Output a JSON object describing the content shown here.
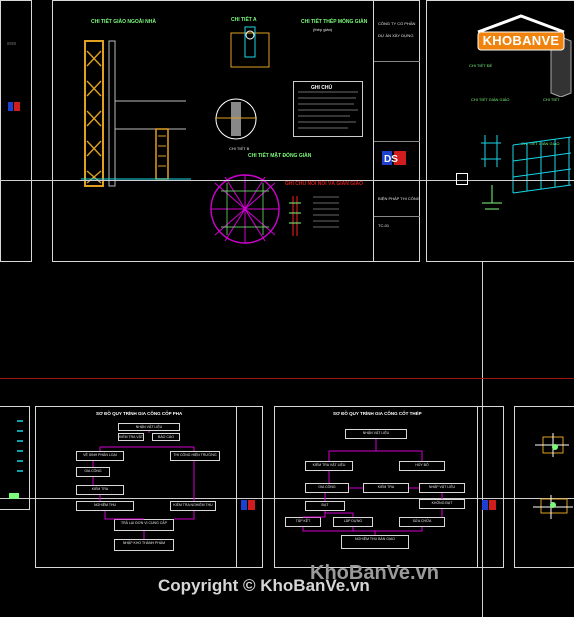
{
  "logo": {
    "text": "KHOBANVE",
    "color": "#f0830d"
  },
  "watermarks": {
    "main": "KhoBanVe.vn",
    "copyright": "Copyright © KhoBanVe.vn"
  },
  "sheet_top_mid": {
    "title_left": "CHI TIẾT GIÀO NGOÀI NHÀ",
    "title_mid": "CHI TIẾT A",
    "title_right": "CHI TIẾT THÉP MÓNG GIÀN",
    "subtitle_right": "(thép giàn)",
    "title_bottom": "CHI TIẾT MẶT ĐÓNG GIÀN",
    "detail_b": "CHI TIẾT B",
    "notes_title": "GHI CHÚ",
    "notes_title2": "GHI CHÚ NỐI NỐI VÀ GIÀN GIÀO",
    "sheet_label": "BẢN VẼ THI CÔNG"
  },
  "sheet_top_right": {
    "label1": "CHI TIẾT ĐẾ",
    "label2": "CHI TIẾT GIÀN GIÁO",
    "label3": "CHI TIẾT",
    "label4": "CHI TIẾT GIÀN GIÁO"
  },
  "sheet_bottom_mid": {
    "title": "SƠ ĐỒ QUY TRÌNH GIA CÔNG CỐP PHA",
    "nodes": [
      "NHẬN VẬT LIỆU",
      "KIỂM TRA VẬT LIỆU",
      "BÁO CÁO",
      "VỆ SINH PHÂN LOẠI",
      "THI CÔNG HIỆN TRƯỜNG",
      "GIA CÔNG",
      "KIỂM TRA",
      "NGHIỆM THU",
      "KIỂM TRA NGHIỆM THU",
      "TRẢ LẠI ĐƠN VỊ CUNG CẤP",
      "NHẬP KHO THÀNH PHẨM",
      "BÀN GIAO CHO BỘ PHẬN LẮP DỰNG"
    ]
  },
  "sheet_bottom_right": {
    "title": "SƠ ĐỒ QUY TRÌNH GIA CÔNG CỐT THÉP",
    "nodes": [
      "NHẬN VẬT LIỆU",
      "KIỂM TRA VẬT LIỆU",
      "NHẬP VẬT LIỆU",
      "HỦY BỎ",
      "GIA CÔNG",
      "KIỂM TRA",
      "ĐẠT",
      "KHÔNG ĐẠT",
      "SỬA CHỮA",
      "TẬP KẾT",
      "LẮP DỰNG",
      "NGHIỆM THU BÀN GIAO"
    ]
  },
  "title_block": {
    "company": "CÔNG TY CỔ PHẦN",
    "project": "DỰ ÁN XÂY DỰNG",
    "drawing": "BIỆN PHÁP THI CÔNG",
    "sheet_no": "TC-01"
  },
  "colors": {
    "sheet_border": "#d8d8d8",
    "red_axis": "#d01c1c",
    "crosshair": "#ffffff",
    "rebar": "#e0a020",
    "magenta": "#d000d0",
    "cyan": "#17d6e6",
    "green": "#7CFC7C"
  }
}
